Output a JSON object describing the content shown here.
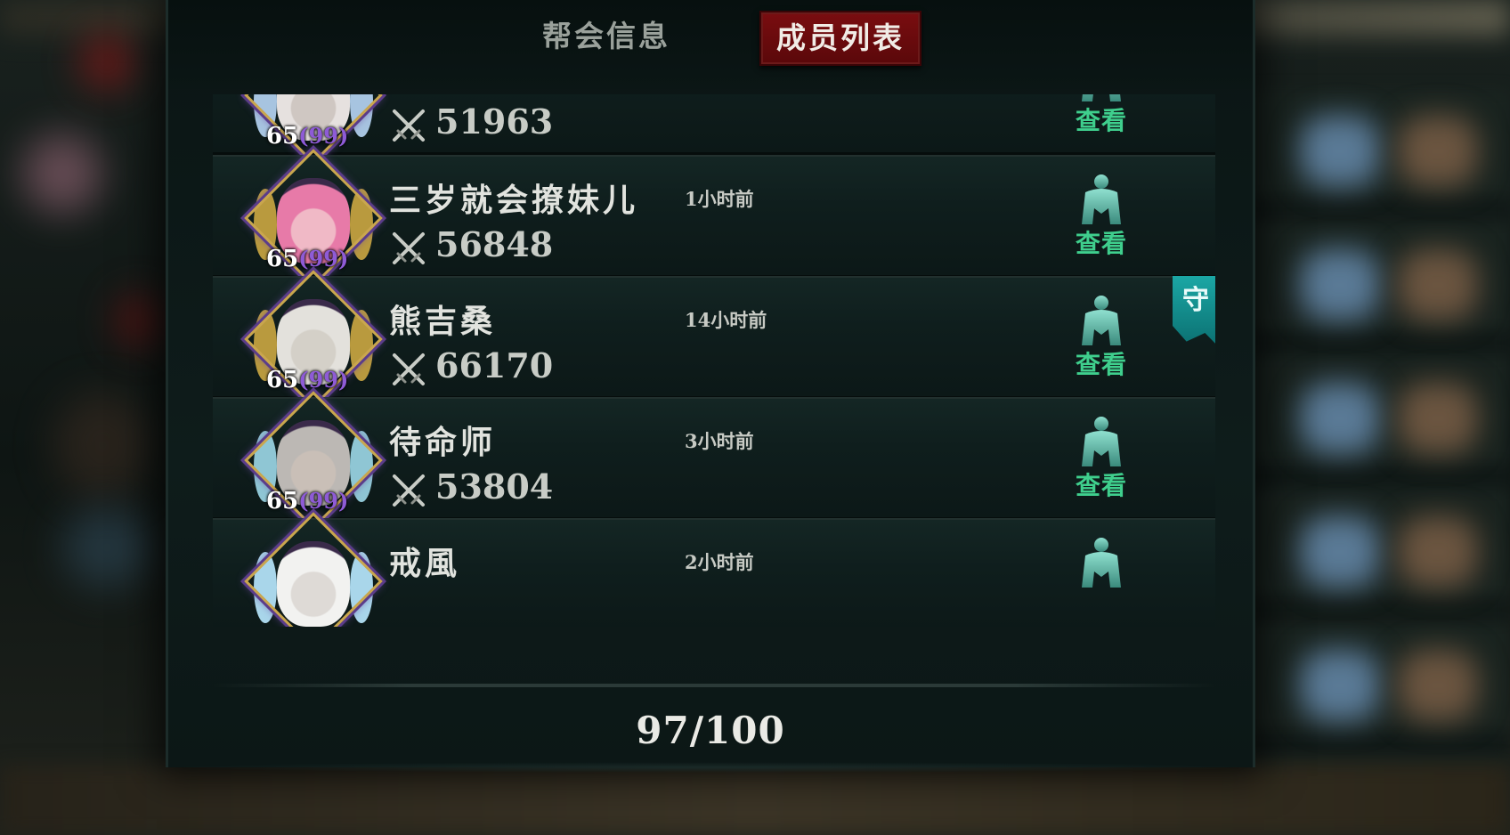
{
  "tabs": [
    {
      "label": "帮会信息",
      "active": false
    },
    {
      "label": "成员列表",
      "active": true
    }
  ],
  "members": [
    {
      "name": "",
      "last_online": "",
      "power": "51963",
      "level": "65",
      "star": "99",
      "view_label": "查看",
      "guard": false,
      "palette": {
        "face": "#cfc7c2",
        "hair": "#e6e1df",
        "wing": "#a7c4e0"
      }
    },
    {
      "name": "三岁就会撩妹儿",
      "last_online": "1小时前",
      "power": "56848",
      "level": "65",
      "star": "99",
      "view_label": "查看",
      "guard": false,
      "palette": {
        "face": "#f0b9c6",
        "hair": "#e77aa8",
        "wing": "#b99a3e"
      }
    },
    {
      "name": "熊吉桑",
      "last_online": "14小时前",
      "power": "66170",
      "level": "65",
      "star": "99",
      "view_label": "查看",
      "guard": true,
      "guard_label": "守",
      "palette": {
        "face": "#d4d0c8",
        "hair": "#e3e1dc",
        "wing": "#b99a3e"
      }
    },
    {
      "name": "待命师",
      "last_online": "3小时前",
      "power": "53804",
      "level": "65",
      "star": "99",
      "view_label": "查看",
      "guard": false,
      "palette": {
        "face": "#c9bfb7",
        "hair": "#bcb8b4",
        "wing": "#8fc6d4"
      }
    },
    {
      "name": "戒風",
      "last_online": "2小时前",
      "power": "",
      "level": "",
      "star": "",
      "view_label": "",
      "guard": false,
      "palette": {
        "face": "#dedad6",
        "hair": "#f2f2f0",
        "wing": "#a9d6ea"
      }
    }
  ],
  "member_count": "97/100",
  "colors": {
    "accent_green": "#3fcf8d",
    "tab_active": "#7a0d10",
    "guard_badge": "#1ba7a5"
  },
  "icons": {
    "power": "crossed-swords-icon",
    "view": "character-silhouette-icon"
  }
}
